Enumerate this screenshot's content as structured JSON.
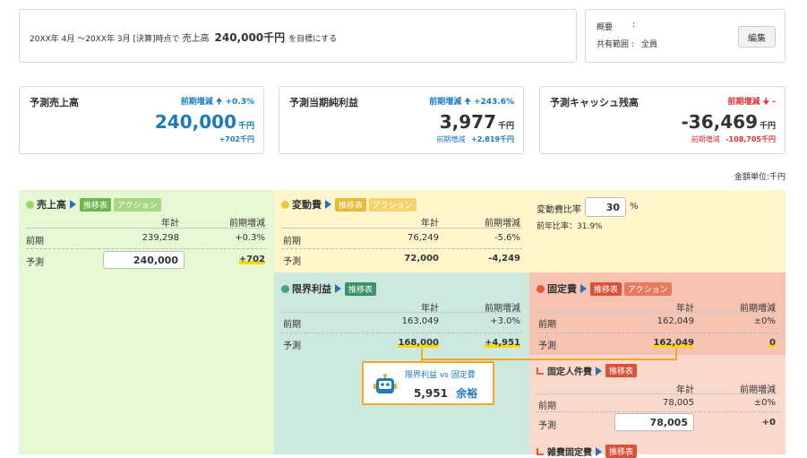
{
  "goal": {
    "period": "20XX年 4月 〜20XX年 3月 [決算]時点で",
    "metric_label": "売上高",
    "target": "240,000千円",
    "suffix": "を目標にする"
  },
  "info": {
    "summary_label": "概要",
    "summary_sep": ":",
    "scope_label": "共有範囲 :",
    "scope_value": "全員",
    "edit_button": "編集"
  },
  "kpis": [
    {
      "title": "予測売上高",
      "delta_label": "前期増減",
      "delta": "+0.3%",
      "value": "240,000",
      "unit": "千円",
      "sub": "+702千円",
      "color": "#1a7bbf"
    },
    {
      "title": "予測当期純利益",
      "delta_label": "前期増減",
      "delta": "+243.6%",
      "value": "3,977",
      "unit": "千円",
      "sub_label": "前期増減",
      "sub": "+2,819千円",
      "color": "#1a7bbf"
    },
    {
      "title": "予測キャッシュ残高",
      "delta_label": "前期増減",
      "delta": "-",
      "value": "-36,469",
      "unit": "千円",
      "sub_label": "前期増減",
      "sub": "-108,705千円",
      "color": "#e0302f"
    }
  ],
  "unit_note": "金額単位:千円",
  "common": {
    "chart_tag": "推移表",
    "action_tag": "アクション",
    "col_annual": "年計",
    "col_change": "前期増減",
    "row_prev": "前期",
    "row_forecast": "予測"
  },
  "sales": {
    "title": "売上高",
    "prev": "239,298",
    "prev_change": "+0.3%",
    "forecast": "240,000",
    "forecast_change": "+702"
  },
  "variable": {
    "title": "変動費",
    "prev": "76,249",
    "prev_change": "-5.6%",
    "forecast": "72,000",
    "forecast_change": "-4,249"
  },
  "ratio": {
    "label": "変動費比率",
    "value": "30",
    "unit": "%",
    "prev_label": "前年比率：31.9%"
  },
  "marginal": {
    "title": "限界利益",
    "prev": "163,049",
    "prev_change": "+3.0%",
    "forecast": "168,000",
    "forecast_change": "+4,951"
  },
  "fixed": {
    "title": "固定費",
    "prev": "162,049",
    "prev_change": "±0%",
    "forecast": "162,049",
    "forecast_change": "0"
  },
  "personnel": {
    "title": "固定人件費",
    "prev": "78,005",
    "prev_change": "±0%",
    "forecast": "78,005",
    "forecast_change": "+0"
  },
  "other_fixed": {
    "title": "雑費固定費"
  },
  "tooltip": {
    "title": "限界利益 vs 固定費",
    "value": "5,951",
    "status": "余裕"
  }
}
